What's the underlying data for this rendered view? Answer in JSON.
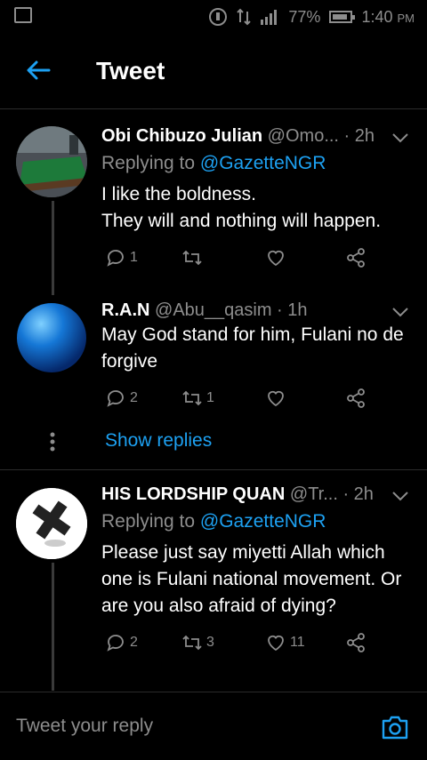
{
  "status_bar": {
    "battery": "77%",
    "time": "1:40",
    "ampm": "PM"
  },
  "header": {
    "title": "Tweet"
  },
  "tweets": [
    {
      "name": "Obi Chibuzo Julian",
      "handle_time": "@Omo... · 2h",
      "replying_prefix": "Replying to ",
      "replying_to": "@GazetteNGR",
      "text_line1": "I like the boldness.",
      "text_line2": "They will and nothing will happen.",
      "replies": "1",
      "retweets": "",
      "likes": ""
    },
    {
      "name": "R.A.N",
      "handle_time": "@Abu__qasim · 1h",
      "text_line1": "May God stand for him, Fulani no de",
      "text_line2": "forgive",
      "replies": "2",
      "retweets": "1",
      "likes": ""
    },
    {
      "name": "HIS LORDSHIP QUAN",
      "handle_time": "@Tr... · 2h",
      "replying_prefix": "Replying to ",
      "replying_to": "@GazetteNGR",
      "text_line1": "Please just say miyetti Allah which",
      "text_line2": "one is Fulani national movement. Or",
      "text_line3": "are you also afraid of dying?",
      "replies": "2",
      "retweets": "3",
      "likes": "11"
    }
  ],
  "show_replies": "Show replies",
  "reply_input": {
    "placeholder": "Tweet your reply"
  },
  "colors": {
    "accent": "#1da1f2",
    "muted": "#8d8d8d",
    "background": "#000000"
  }
}
